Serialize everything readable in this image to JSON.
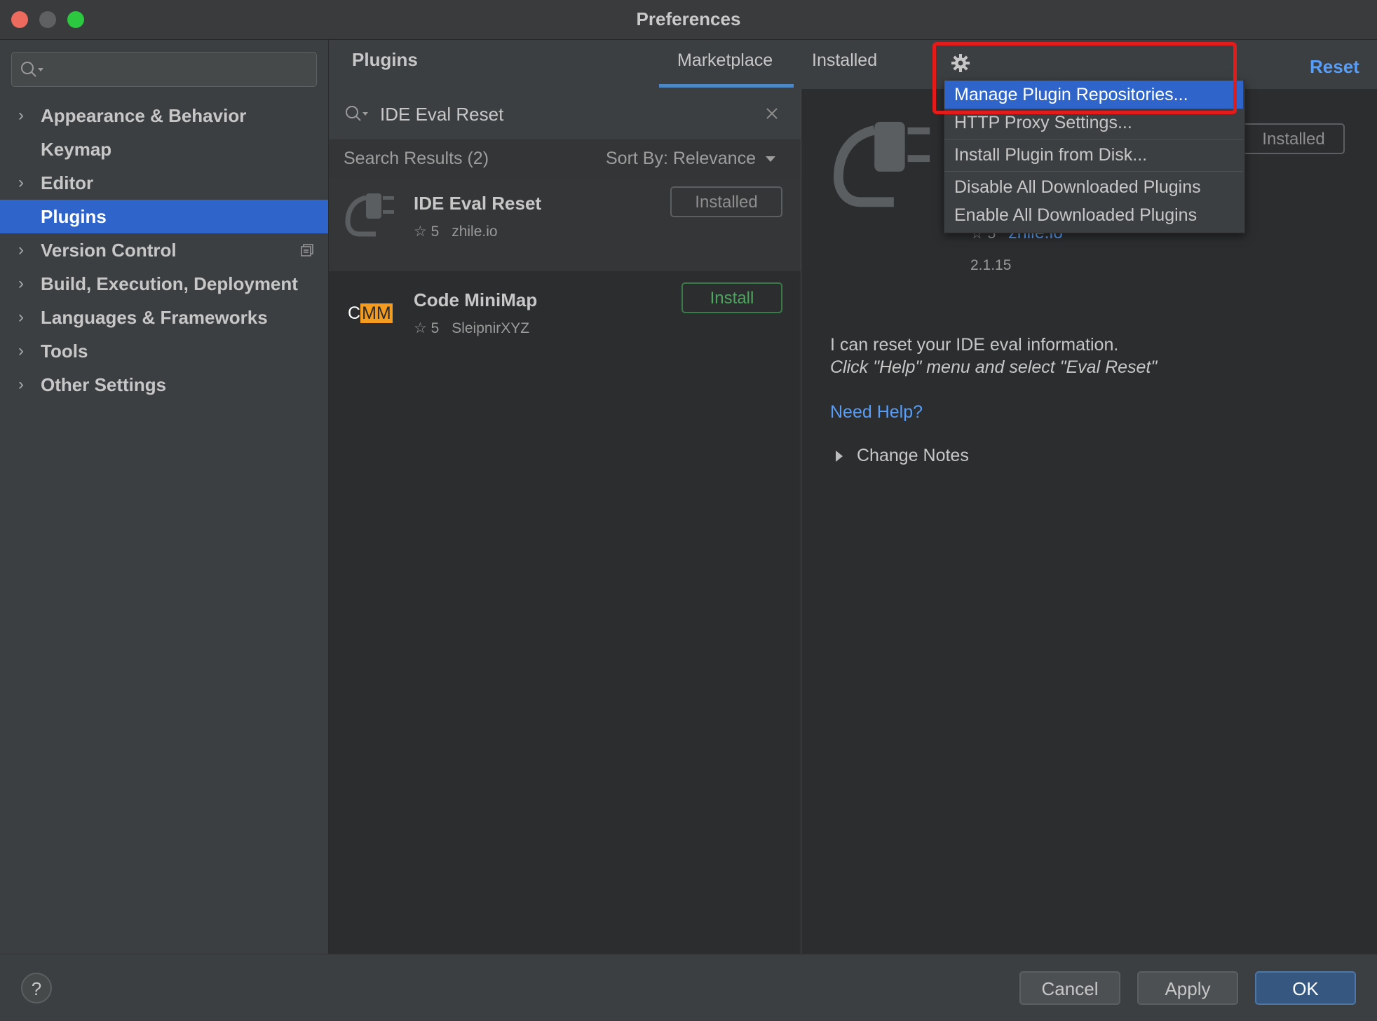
{
  "window": {
    "title": "Preferences"
  },
  "sidebar": {
    "search_placeholder": "",
    "items": [
      {
        "label": "Appearance & Behavior",
        "expandable": true
      },
      {
        "label": "Keymap",
        "expandable": false
      },
      {
        "label": "Editor",
        "expandable": true
      },
      {
        "label": "Plugins",
        "expandable": false,
        "selected": true
      },
      {
        "label": "Version Control",
        "expandable": true
      },
      {
        "label": "Build, Execution, Deployment",
        "expandable": true
      },
      {
        "label": "Languages & Frameworks",
        "expandable": true
      },
      {
        "label": "Tools",
        "expandable": true
      },
      {
        "label": "Other Settings",
        "expandable": true
      }
    ]
  },
  "header": {
    "title": "Plugins",
    "tabs": [
      {
        "label": "Marketplace",
        "active": true
      },
      {
        "label": "Installed",
        "active": false
      }
    ],
    "reset_label": "Reset"
  },
  "search": {
    "value": "IDE Eval Reset"
  },
  "results": {
    "count_label": "Search Results (2)",
    "sort_label": "Sort By: Relevance",
    "plugins": [
      {
        "name": "IDE Eval Reset",
        "rating": "5",
        "vendor": "zhile.io",
        "button": "Installed",
        "selected": true
      },
      {
        "name": "Code MiniMap",
        "rating": "5",
        "vendor": "SleipnirXYZ",
        "button": "Install",
        "logo_c": "C",
        "logo_mm": "MM"
      }
    ]
  },
  "detail": {
    "button": "Installed",
    "rating": "5",
    "vendor": "zhile.io",
    "version": "2.1.15",
    "description": "I can reset your IDE eval information.",
    "description_italic": "Click \"Help\" menu and select \"Eval Reset\"",
    "help_link": "Need Help?",
    "change_notes": "Change Notes"
  },
  "menu": {
    "items": [
      {
        "label": "Manage Plugin Repositories...",
        "highlighted": true
      },
      {
        "label": "HTTP Proxy Settings..."
      },
      {
        "label": "Install Plugin from Disk..."
      },
      {
        "label": "Disable All Downloaded Plugins"
      },
      {
        "label": "Enable All Downloaded Plugins"
      }
    ]
  },
  "footer": {
    "cancel": "Cancel",
    "apply": "Apply",
    "ok": "OK",
    "help": "?"
  },
  "colors": {
    "accent": "#2f65ca",
    "link": "#589df6",
    "highlight_box": "#e31b1b",
    "install_green": "#4fa55f",
    "minimap_orange": "#f39c1f"
  }
}
